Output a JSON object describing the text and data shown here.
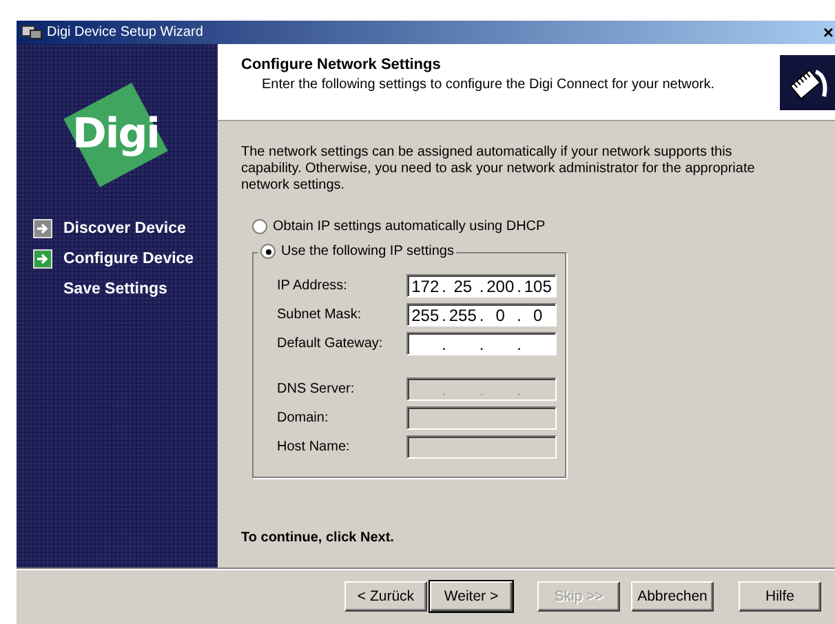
{
  "window": {
    "title": "Digi Device Setup Wizard",
    "close": "×"
  },
  "sidebar": {
    "logo": "Digi",
    "steps": [
      {
        "label": "Discover Device",
        "done": true,
        "current": false
      },
      {
        "label": "Configure Device",
        "done": false,
        "current": true
      },
      {
        "label": "Save Settings",
        "done": false,
        "current": false
      }
    ]
  },
  "header": {
    "title": "Configure Network Settings",
    "subtitle": "Enter the following settings to configure the Digi Connect for your network."
  },
  "intro": "The network settings can be assigned automatically if your network supports this capability. Otherwise, you need to ask your network administrator for the appropriate network settings.",
  "options": [
    {
      "label": "Obtain IP settings automatically using DHCP",
      "selected": false
    },
    {
      "label": "Use the following IP settings",
      "selected": true
    }
  ],
  "fields": [
    {
      "label": "IP Address:",
      "kind": "ip",
      "separator": ".",
      "octets": [
        "172",
        "25",
        "200",
        "105"
      ],
      "disabled": false
    },
    {
      "label": "Subnet Mask:",
      "kind": "ip",
      "separator": ".",
      "octets": [
        "255",
        "255",
        "0",
        "0"
      ],
      "disabled": false
    },
    {
      "label": "Default Gateway:",
      "kind": "ip",
      "separator": ".",
      "disabled": false
    },
    {
      "label": "DNS Server:",
      "kind": "ip",
      "separator": ".",
      "disabled": true
    },
    {
      "label": "Domain:",
      "kind": "text",
      "disabled": true
    },
    {
      "label": "Host Name:",
      "kind": "text",
      "disabled": true
    }
  ],
  "footer_text": "To continue, click Next.",
  "buttons": [
    {
      "label": "< Zurück",
      "default": false,
      "disabled": false
    },
    {
      "label": "Weiter >",
      "default": true,
      "disabled": false
    },
    {
      "label": "Skip >>",
      "default": false,
      "disabled": true
    },
    {
      "label": "Abbrechen",
      "default": false,
      "disabled": false
    },
    {
      "label": "Hilfe",
      "default": false,
      "disabled": false
    }
  ]
}
